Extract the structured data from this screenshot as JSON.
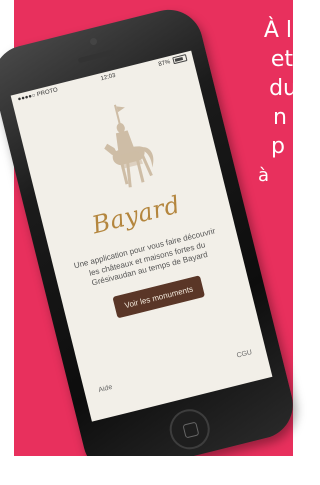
{
  "promo": {
    "lines": [
      "À l’",
      "et",
      "du",
      "n",
      "p",
      "à"
    ]
  },
  "status_bar": {
    "carrier": "●●●●○ PROTO",
    "time": "12:03",
    "battery": "87%"
  },
  "app": {
    "title": "Bayard",
    "description": "Une application pour vous faire découvrir les châteaux et maisons fortes du Grésivaudan au temps de Bayard",
    "cta_label": "Voir les monuments",
    "help_label": "Aide",
    "cgu_label": "CGU"
  },
  "colors": {
    "accent_pink": "#e8305d",
    "title_gold": "#b4863e",
    "button_brown": "#5a3627"
  }
}
